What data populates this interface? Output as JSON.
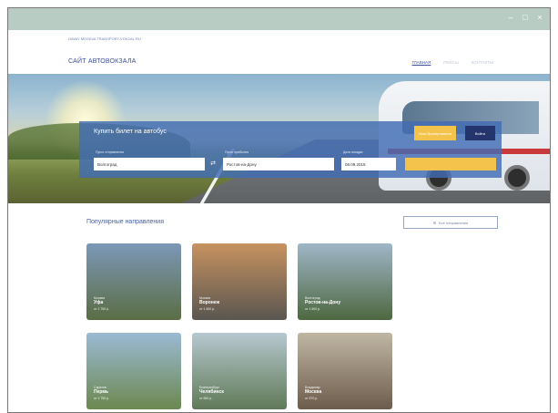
{
  "window": {
    "controls": [
      "–",
      "□",
      "×"
    ]
  },
  "topline": {
    "text": "DAVAY MOSKVA TRANSPORT-VOKZAL.RU"
  },
  "header": {
    "logo": "САЙТ АВТОВОКЗАЛА",
    "nav": [
      {
        "label": "ГЛАВНАЯ",
        "active": true
      },
      {
        "label": "РЕЙСЫ",
        "active": false
      },
      {
        "label": "КОНТАКТЫ",
        "active": false
      }
    ]
  },
  "search": {
    "title": "Купить билет на автобус",
    "btn_one": "Мои бронирования",
    "btn_two": "Войти",
    "from_label": "Пункт отправления",
    "from_value": "Волгоград",
    "to_label": "Пункт прибытия",
    "to_value": "Ростов-на-Дону",
    "date_label": "Дата поездки",
    "date_value": "08.09.2015",
    "swap_icon": "⇄",
    "find_label": ""
  },
  "popular": {
    "title": "Популярные направления",
    "all_label": "Все направления",
    "cards": [
      {
        "to": "Москва",
        "city": "Уфа",
        "price": "от 1 750 р.",
        "colors": [
          "#7c98b8",
          "#5a6d44"
        ]
      },
      {
        "to": "Москва",
        "city": "Воронеж",
        "price": "от 1 600 р.",
        "colors": [
          "#c79260",
          "#5a5650"
        ]
      },
      {
        "to": "Волгоград",
        "city": "Ростов-на-Дону",
        "price": "от 1 600 р.",
        "colors": [
          "#9fb6c8",
          "#4e6840"
        ]
      },
      {
        "to": "Саратов",
        "city": "Пермь",
        "price": "от 1 750 р.",
        "colors": [
          "#9bbad4",
          "#6c8850"
        ]
      },
      {
        "to": "Екатеринбург",
        "city": "Челябинск",
        "price": "от 650 р.",
        "colors": [
          "#b7c8cf",
          "#5f7a58"
        ]
      },
      {
        "to": "Владимир",
        "city": "Москва",
        "price": "от 570 р.",
        "colors": [
          "#c0b6a4",
          "#6d5c4c"
        ]
      }
    ]
  }
}
